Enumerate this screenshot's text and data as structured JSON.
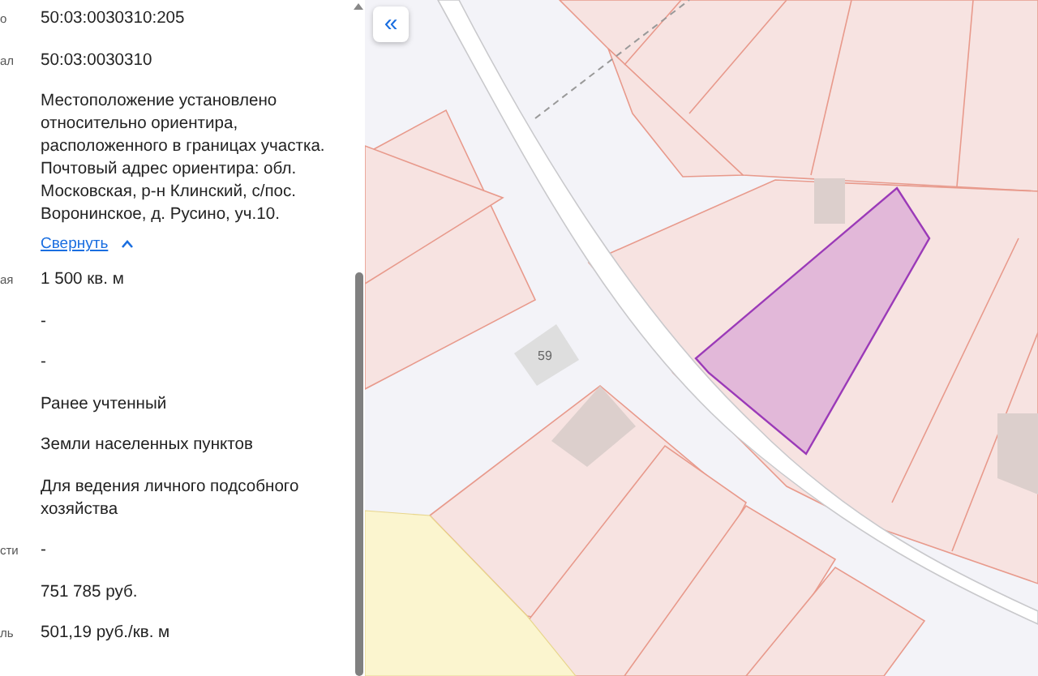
{
  "details": [
    {
      "kind": "field",
      "label": "о",
      "value": "50:03:0030310:205"
    },
    {
      "kind": "field",
      "label": "ал",
      "value": "50:03:0030310"
    },
    {
      "kind": "address",
      "value": "Местоположение установлено относительно ориентира, расположенного в границах участка. Почтовый адрес ориентира: обл. Московская, р-н Клинский, с/пос. Воронинское, д. Русино, уч.10.",
      "link": "Свернуть",
      "expanded": true
    },
    {
      "kind": "field",
      "label": "ая",
      "value": "1 500 кв. м"
    },
    {
      "kind": "field",
      "value": "-"
    },
    {
      "kind": "field",
      "value": "-"
    },
    {
      "kind": "field",
      "value": "Ранее учтенный"
    },
    {
      "kind": "field",
      "value": "Земли населенных пунктов"
    },
    {
      "kind": "field",
      "value": "Для ведения личного подсобного хозяйства"
    },
    {
      "kind": "field",
      "label": "сти",
      "value": "-"
    },
    {
      "kind": "field",
      "value": "751 785 руб."
    },
    {
      "kind": "field",
      "label": "ль",
      "value": "501,19 руб./кв. м"
    }
  ],
  "map": {
    "house_number": "59",
    "collapse_button": "«"
  }
}
